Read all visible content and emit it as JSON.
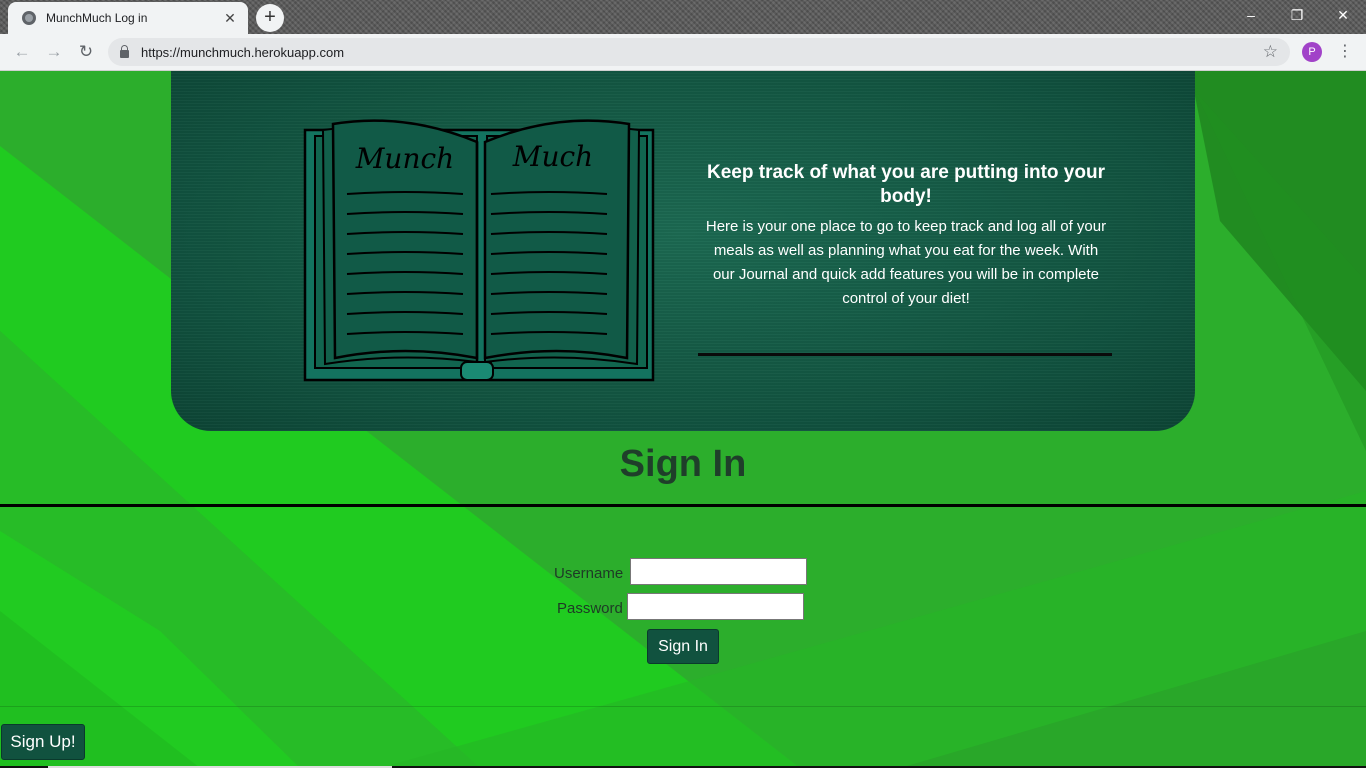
{
  "browser": {
    "tab_title": "MunchMuch Log in",
    "tab_close": "✕",
    "new_tab": "+",
    "url": "https://munchmuch.herokuapp.com",
    "profile_initial": "P",
    "window_controls": [
      "–",
      "❐",
      "✕"
    ],
    "nav": {
      "back": "←",
      "forward": "→",
      "reload": "↻"
    },
    "star": "☆",
    "menu": "⋮"
  },
  "hero": {
    "book_left_word": "Munch",
    "book_right_word": "Much",
    "title": "Keep track of what you are putting into your body!",
    "body": "Here is your one place to go to keep track and log all of your meals as well as planning what you eat for the week. With our Journal and quick add features you will be in complete control of your diet!"
  },
  "signin": {
    "heading": "Sign In",
    "username_label": "Username",
    "password_label": "Password",
    "username_value": "",
    "password_value": "",
    "submit_label": "Sign In"
  },
  "footer": {
    "signup_label": "Sign Up!"
  },
  "colors": {
    "page_green": "#2cae2c",
    "hero_teal": "#11523f",
    "button_teal": "#11523f"
  }
}
